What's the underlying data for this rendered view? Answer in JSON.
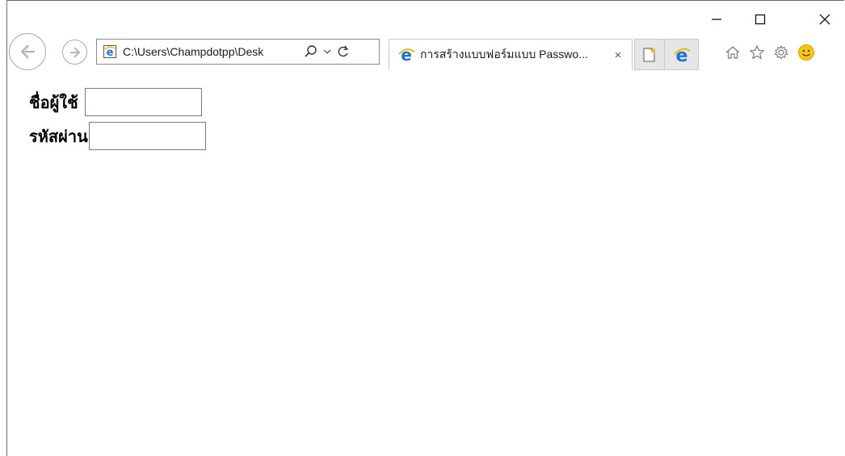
{
  "browser": {
    "address": "C:\\Users\\Champdotpp\\Desk",
    "tab_title": "การสร้างแบบฟอร์มแบบ Passwo...",
    "tab_close": "×"
  },
  "form": {
    "username_label": "ชื่อผู้ใช้",
    "username_value": "",
    "password_label": "รหัสผ่าน",
    "password_value": ""
  },
  "colors": {
    "ie_blue": "#1a73d6",
    "ie_gold": "#f2b600",
    "smiley": "#f5c518"
  }
}
